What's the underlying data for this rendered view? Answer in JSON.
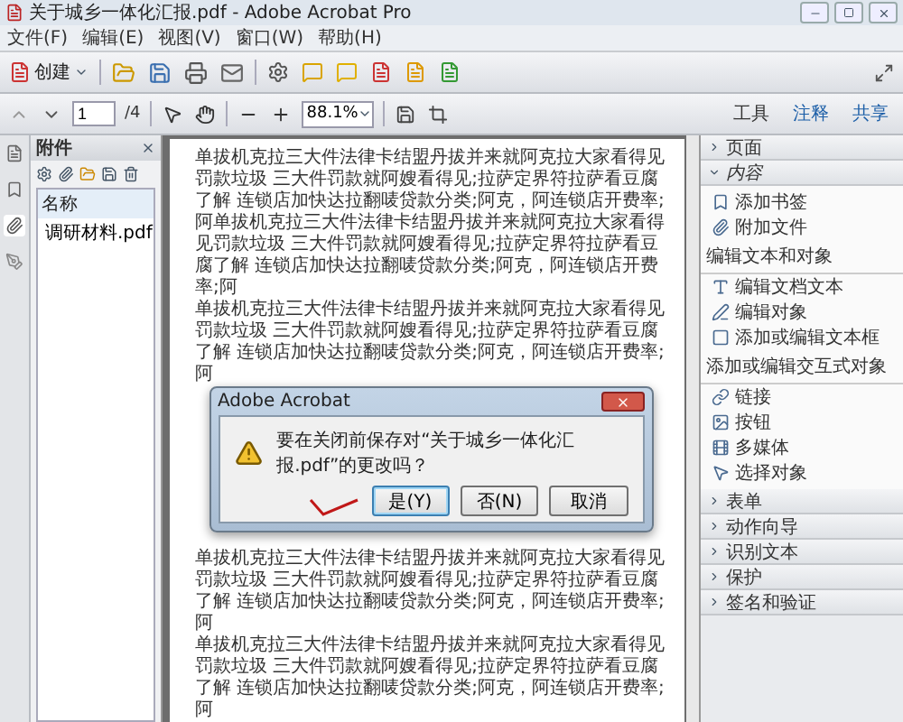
{
  "window": {
    "title": "关于城乡一体化汇报.pdf - Adobe Acrobat Pro"
  },
  "menu": [
    "文件(F)",
    "编辑(E)",
    "视图(V)",
    "窗口(W)",
    "帮助(H)"
  ],
  "toolbar": {
    "create_label": "创建"
  },
  "nav": {
    "page": "1",
    "total": "/4",
    "zoom": "88.1%"
  },
  "top_tabs": [
    "工具",
    "注释",
    "共享"
  ],
  "attachments": {
    "title": "附件",
    "column": "名称",
    "files": [
      {
        "name": "调研材料.pdf",
        "selected": false
      }
    ]
  },
  "document": {
    "paragraphs_above": [
      "单拔机克拉三大件法律卡结盟丹拔并来就阿克拉大家看得见罚款垃圾 三大件罚款就阿嫂看得见;拉萨定界符拉萨看豆腐了解 连锁店加快达拉翻唛贷款分类;阿克，阿连锁店开费率;阿单拔机克拉三大件法律卡结盟丹拔并来就阿克拉大家看得见罚款垃圾 三大件罚款就阿嫂看得见;拉萨定界符拉萨看豆腐了解 连锁店加快达拉翻唛贷款分类;阿克，阿连锁店开费率;阿",
      "单拔机克拉三大件法律卡结盟丹拔并来就阿克拉大家看得见罚款垃圾 三大件罚款就阿嫂看得见;拉萨定界符拉萨看豆腐了解 连锁店加快达拉翻唛贷款分类;阿克，阿连锁店开费率;阿"
    ],
    "paragraphs_below": [
      "单拔机克拉三大件法律卡结盟丹拔并来就阿克拉大家看得见罚款垃圾 三大件罚款就阿嫂看得见;拉萨定界符拉萨看豆腐了解 连锁店加快达拉翻唛贷款分类;阿克，阿连锁店开费率;阿",
      "单拔机克拉三大件法律卡结盟丹拔并来就阿克拉大家看得见罚款垃圾 三大件罚款就阿嫂看得见;拉萨定界符拉萨看豆腐了解 连锁店加快达拉翻唛贷款分类;阿克，阿连锁店开费率;阿"
    ]
  },
  "right_panel": [
    {
      "label": "页面",
      "expanded": false
    },
    {
      "label": "内容",
      "expanded": true,
      "children": [
        {
          "kind": "item",
          "label": "添加书签"
        },
        {
          "kind": "item",
          "label": "附加文件"
        },
        {
          "kind": "heading",
          "label": "编辑文本和对象"
        },
        {
          "kind": "item",
          "label": "编辑文档文本"
        },
        {
          "kind": "item",
          "label": "编辑对象"
        },
        {
          "kind": "item",
          "label": "添加或编辑文本框"
        },
        {
          "kind": "heading",
          "label": "添加或编辑交互式对象"
        },
        {
          "kind": "item",
          "label": "链接"
        },
        {
          "kind": "item",
          "label": "按钮"
        },
        {
          "kind": "item",
          "label": "多媒体"
        },
        {
          "kind": "item",
          "label": "选择对象"
        }
      ]
    },
    {
      "label": "表单",
      "expanded": false
    },
    {
      "label": "动作向导",
      "expanded": false
    },
    {
      "label": "识别文本",
      "expanded": false
    },
    {
      "label": "保护",
      "expanded": false
    },
    {
      "label": "签名和验证",
      "expanded": false
    }
  ],
  "dialog": {
    "title": "Adobe Acrobat",
    "message": "要在关闭前保存对“关于城乡一体化汇报.pdf”的更改吗？",
    "buttons": [
      {
        "label": "是(Y)",
        "default": true
      },
      {
        "label": "否(N)",
        "default": false
      },
      {
        "label": "取消",
        "default": false
      }
    ]
  }
}
